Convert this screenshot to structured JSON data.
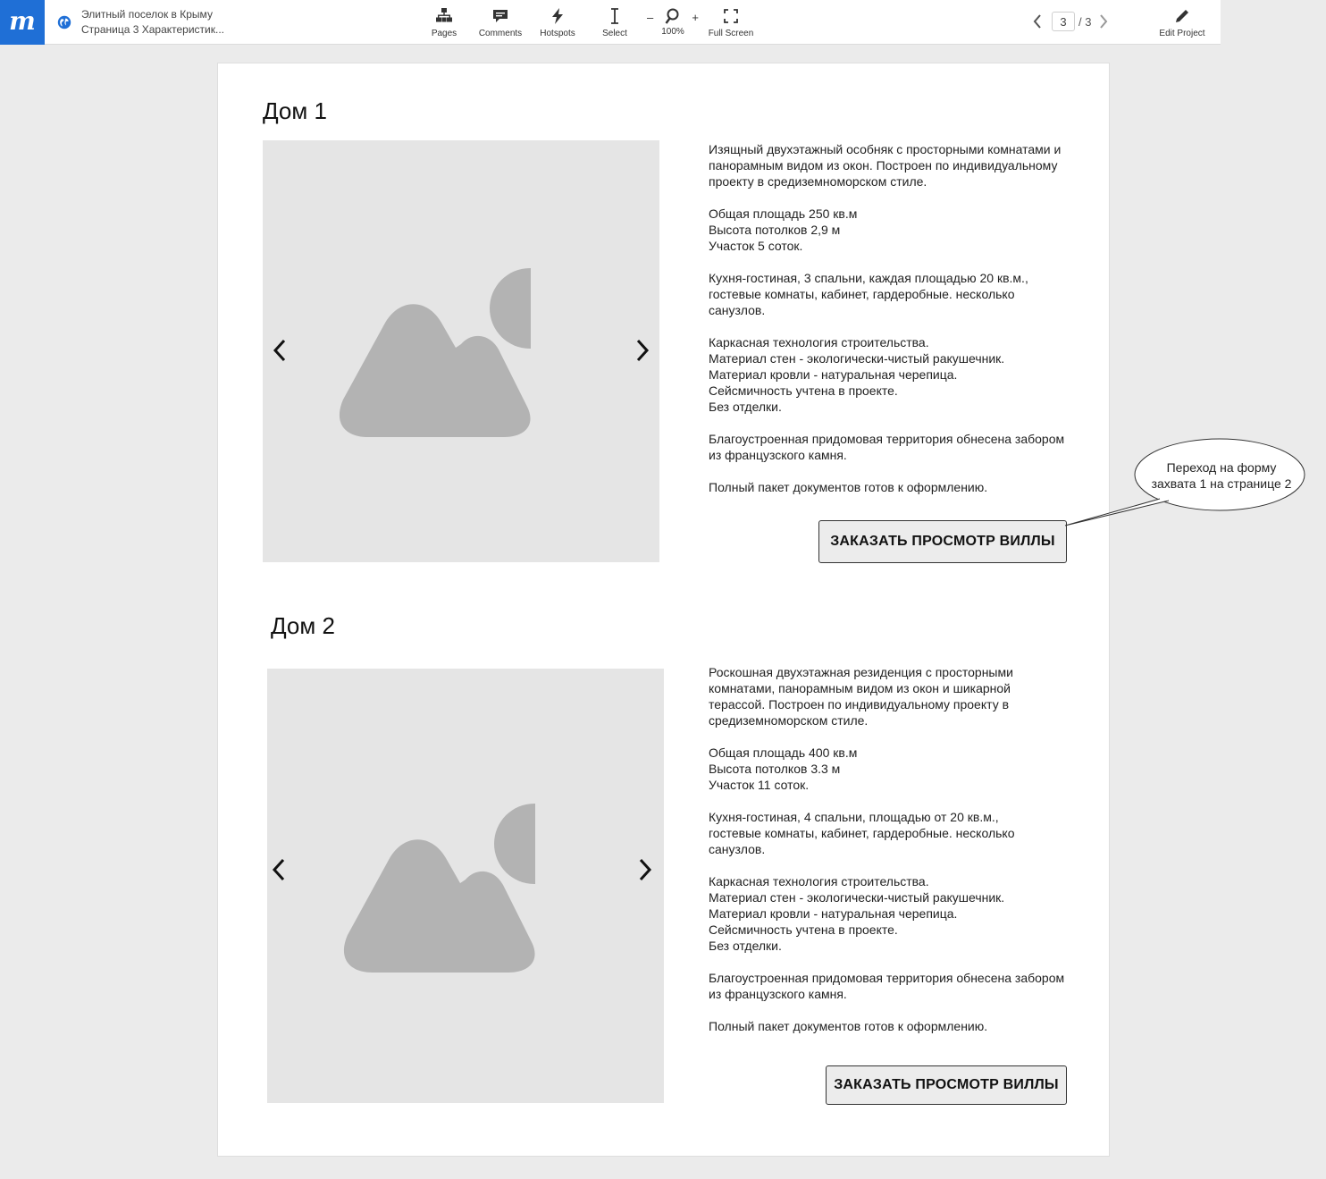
{
  "app": {
    "logo": "m",
    "project_title": "Элитный поселок в Крыму",
    "page_title": "Страница 3 Характеристик..."
  },
  "toolbar": {
    "pages": "Pages",
    "comments": "Comments",
    "hotspots": "Hotspots",
    "select": "Select",
    "zoom_level": "100%",
    "zoom_minus": "–",
    "zoom_plus": "+",
    "full_screen": "Full Screen",
    "edit_project": "Edit Project"
  },
  "pager": {
    "current": "3",
    "total": "/ 3"
  },
  "houses": [
    {
      "title": "Дом 1",
      "intro": [
        "Изящный двухэтажный особняк с просторными комнатами и",
        "панорамным видом из окон. Построен по индивидуальному",
        "проекту в средиземноморском стиле."
      ],
      "specs": [
        "Общая площадь 250 кв.м",
        "Высота потолков 2,9 м",
        "Участок 5 соток."
      ],
      "rooms": [
        "Кухня-гостиная, 3 спальни, каждая площадью 20 кв.м.,",
        "гостевые комнаты, кабинет, гардеробные. несколько",
        "санузлов."
      ],
      "construction": [
        "Каркасная технология строительства.",
        "Материал стен - экологически-чистый ракушечник.",
        "Материал кровли - натуральная черепица.",
        "Сейсмичность учтена в проекте.",
        "Без отделки."
      ],
      "territory": [
        "Благоустроенная придомовая территория обнесена забором",
        "из французского камня."
      ],
      "docs": [
        "Полный пакет документов готов к оформлению."
      ],
      "button": "ЗАКАЗАТЬ ПРОСМОТР ВИЛЛЫ"
    },
    {
      "title": "Дом 2",
      "intro": [
        "Роскошная двухэтажная резиденция с просторными",
        "комнатами, панорамным видом из окон и шикарной",
        "терассой. Построен по индивидуальному проекту в",
        "средиземноморском стиле."
      ],
      "specs": [
        "Общая площадь 400 кв.м",
        "Высота потолков 3.3 м",
        "Участок 11 соток."
      ],
      "rooms": [
        "Кухня-гостиная, 4 спальни, площадью от 20 кв.м.,",
        "гостевые комнаты, кабинет, гардеробные. несколько",
        "санузлов."
      ],
      "construction": [
        "Каркасная технология строительства.",
        "Материал стен - экологически-чистый ракушечник.",
        "Материал кровли - натуральная черепица.",
        "Сейсмичность учтена в проекте.",
        "Без отделки."
      ],
      "territory": [
        "Благоустроенная придомовая территория обнесена забором",
        "из французского камня."
      ],
      "docs": [
        "Полный пакет документов готов к оформлению."
      ],
      "button": "ЗАКАЗАТЬ ПРОСМОТР ВИЛЛЫ"
    }
  ],
  "callout": {
    "lines": [
      "Переход на форму",
      "захвата 1 на странице 2"
    ]
  },
  "colors": {
    "brand": "#1f6fd6",
    "placeholder_bg": "#e5e5e5",
    "placeholder_icon": "#b3b3b3",
    "button_bg": "#ececec"
  },
  "icons": {
    "logo": "moqups-logo-icon",
    "globe": "globe-icon",
    "pages": "sitemap-icon",
    "comments": "comment-icon",
    "hotspots": "lightning-icon",
    "select": "text-cursor-icon",
    "zoom": "magnifier-icon",
    "full_screen": "expand-icon",
    "edit": "pencil-icon",
    "prev": "chevron-left-icon",
    "next": "chevron-right-icon",
    "image": "image-placeholder-icon"
  }
}
